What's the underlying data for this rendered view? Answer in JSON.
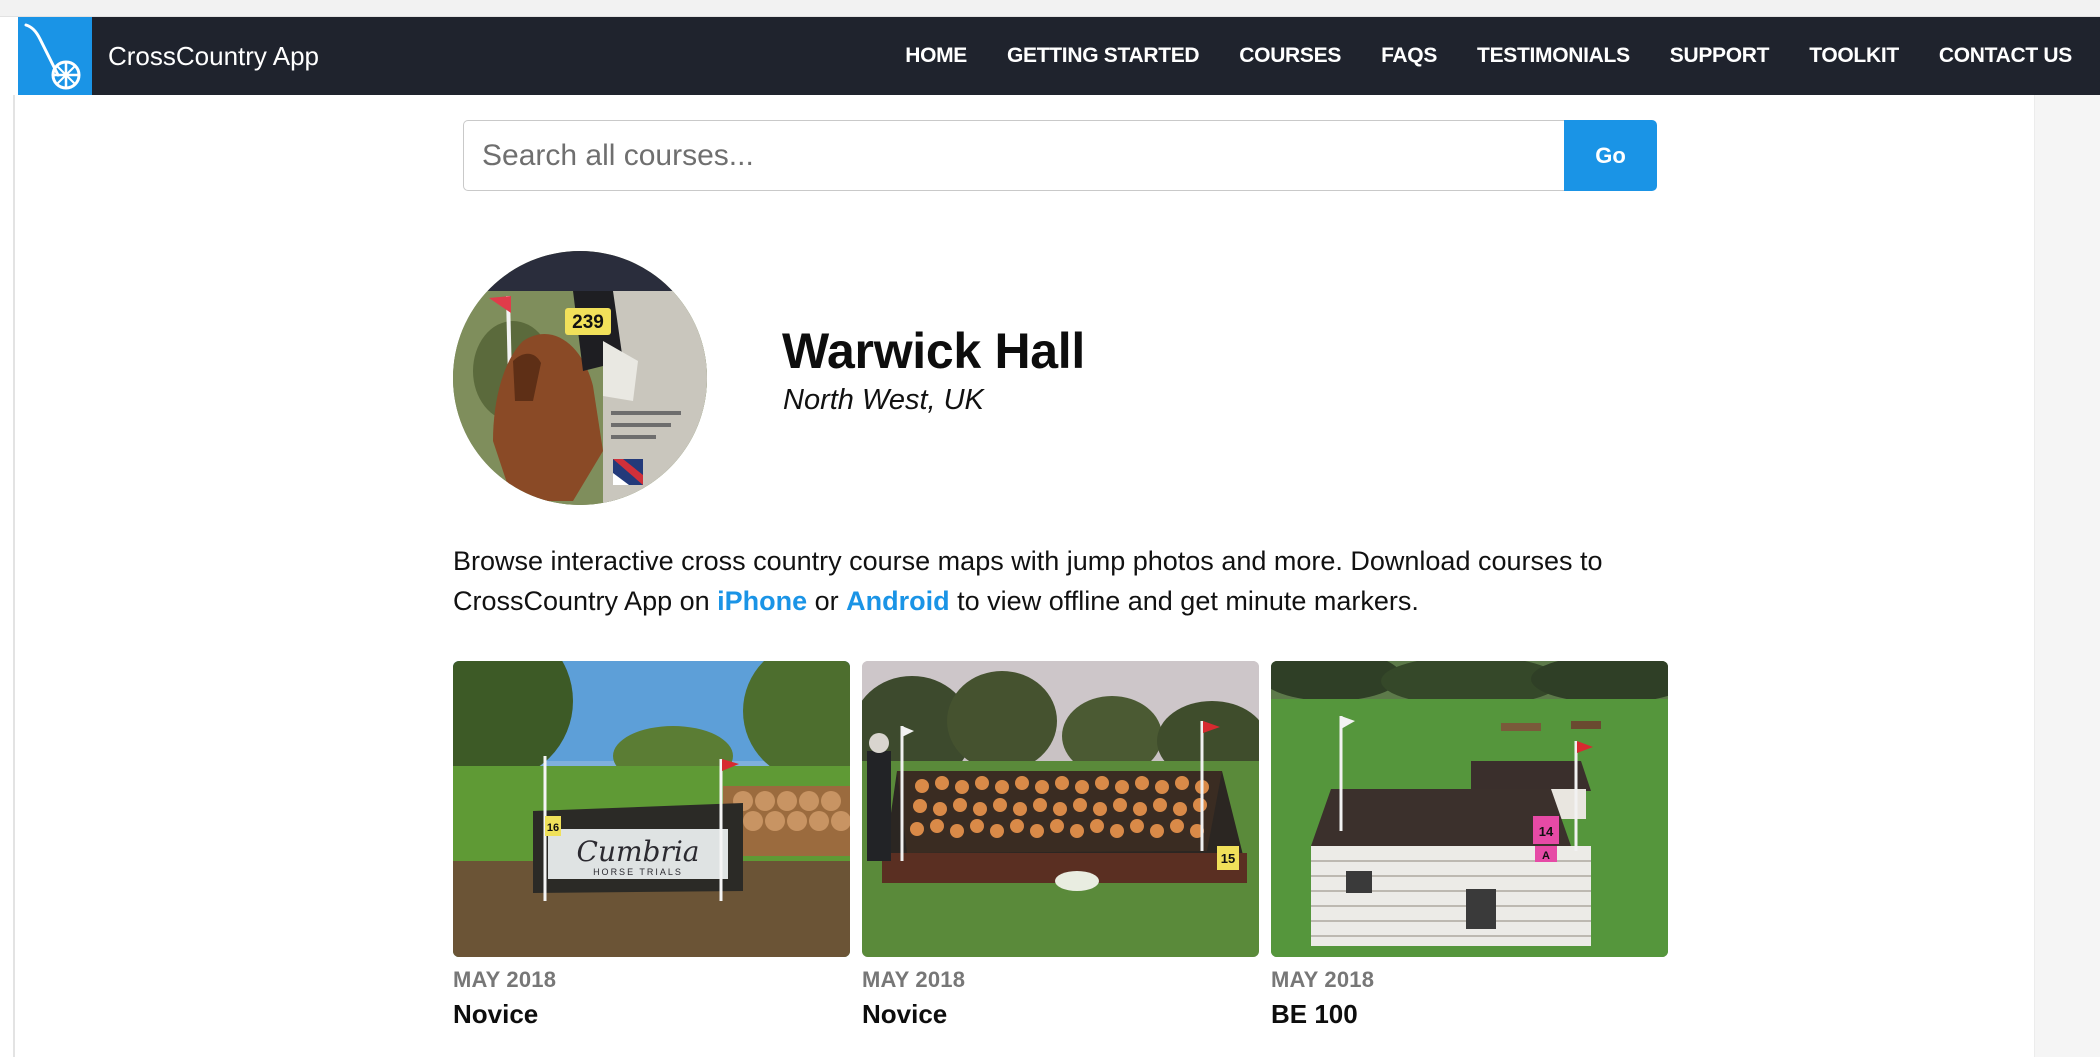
{
  "brand": {
    "name": "CrossCountry App",
    "logo_icon": "course-wheel-icon",
    "accent": "#1a94e6",
    "nav_bg": "#1f232d"
  },
  "nav": {
    "items": [
      {
        "label": "HOME"
      },
      {
        "label": "GETTING STARTED"
      },
      {
        "label": "COURSES"
      },
      {
        "label": "FAQS"
      },
      {
        "label": "TESTIMONIALS"
      },
      {
        "label": "SUPPORT"
      },
      {
        "label": "TOOLKIT"
      },
      {
        "label": "CONTACT US"
      }
    ]
  },
  "search": {
    "placeholder": "Search all courses...",
    "value": "",
    "button_label": "Go"
  },
  "venue": {
    "name": "Warwick Hall",
    "location": "North West, UK",
    "avatar_bib_number": "239"
  },
  "intro": {
    "text_before": "Browse interactive cross country course maps with jump photos and more. Download courses to CrossCountry App on ",
    "iphone_link": "iPhone",
    "text_middle": " or ",
    "android_link": "Android",
    "text_after": " to view offline and get minute markers."
  },
  "courses": [
    {
      "date": "MAY 2018",
      "title": "Novice",
      "fence_number": "16",
      "sign_text": "Cumbria",
      "sign_subtext": "HORSE TRIALS"
    },
    {
      "date": "MAY 2018",
      "title": "Novice",
      "fence_number": "15"
    },
    {
      "date": "MAY 2018",
      "title": "BE 100",
      "fence_number": "14",
      "fence_letter": "A"
    }
  ]
}
